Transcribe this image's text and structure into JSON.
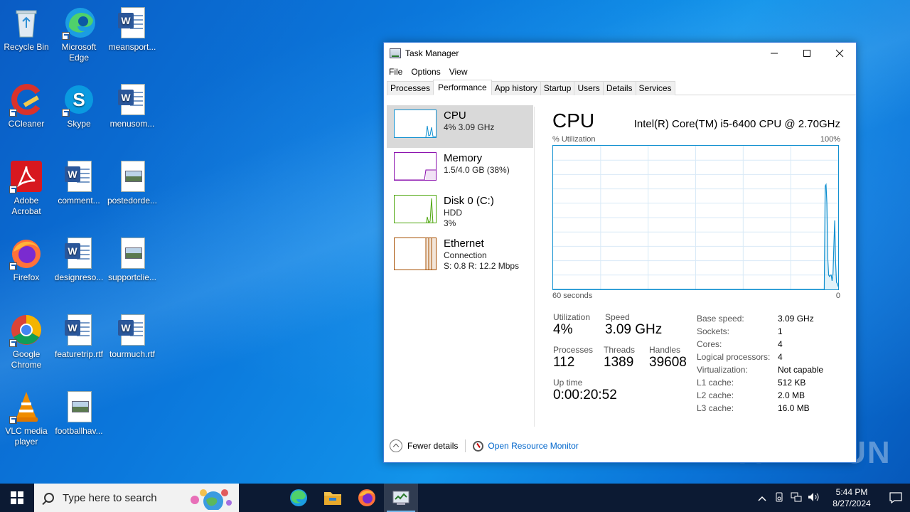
{
  "desktop": {
    "icons": [
      {
        "label": "Recycle Bin"
      },
      {
        "label": "Microsoft Edge"
      },
      {
        "label": "meansport..."
      },
      {
        "label": "CCleaner"
      },
      {
        "label": "Skype"
      },
      {
        "label": "menusom..."
      },
      {
        "label": "Adobe Acrobat"
      },
      {
        "label": "comment..."
      },
      {
        "label": "postedorde..."
      },
      {
        "label": "Firefox"
      },
      {
        "label": "designreso..."
      },
      {
        "label": "supportclie..."
      },
      {
        "label": "Google Chrome"
      },
      {
        "label": "featuretrip.rtf"
      },
      {
        "label": "tourmuch.rtf"
      },
      {
        "label": "VLC media player"
      },
      {
        "label": "footballhav..."
      }
    ]
  },
  "window": {
    "title": "Task Manager",
    "menu": [
      "File",
      "Options",
      "View"
    ],
    "tabs": [
      "Processes",
      "Performance",
      "App history",
      "Startup",
      "Users",
      "Details",
      "Services"
    ],
    "active_tab": "Performance",
    "resources": [
      {
        "name": "CPU",
        "sub1": "4% 3.09 GHz",
        "sub2": "",
        "color": "#1190d0"
      },
      {
        "name": "Memory",
        "sub1": "1.5/4.0 GB (38%)",
        "sub2": "",
        "color": "#8b12ae"
      },
      {
        "name": "Disk 0 (C:)",
        "sub1": "HDD",
        "sub2": "3%",
        "color": "#4da60c"
      },
      {
        "name": "Ethernet",
        "sub1": "Connection",
        "sub2": "S: 0.8 R: 12.2 Mbps",
        "color": "#a74f01"
      }
    ],
    "detail": {
      "heading": "CPU",
      "model": "Intel(R) Core(TM) i5-6400 CPU @ 2.70GHz",
      "graph_top_left": "% Utilization",
      "graph_top_right": "100%",
      "graph_bottom_left": "60 seconds",
      "graph_bottom_right": "0",
      "stats": {
        "utilization_label": "Utilization",
        "utilization": "4%",
        "speed_label": "Speed",
        "speed": "3.09 GHz",
        "processes_label": "Processes",
        "processes": "112",
        "threads_label": "Threads",
        "threads": "1389",
        "handles_label": "Handles",
        "handles": "39608",
        "uptime_label": "Up time",
        "uptime": "0:00:20:52"
      },
      "specs": [
        {
          "k": "Base speed:",
          "v": "3.09 GHz"
        },
        {
          "k": "Sockets:",
          "v": "1"
        },
        {
          "k": "Cores:",
          "v": "4"
        },
        {
          "k": "Logical processors:",
          "v": "4"
        },
        {
          "k": "Virtualization:",
          "v": "Not capable"
        },
        {
          "k": "L1 cache:",
          "v": "512 KB"
        },
        {
          "k": "L2 cache:",
          "v": "2.0 MB"
        },
        {
          "k": "L3 cache:",
          "v": "16.0 MB"
        }
      ]
    },
    "footer": {
      "fewer_details": "Fewer details",
      "resource_monitor": "Open Resource Monitor"
    }
  },
  "cpu_history_percent": [
    0,
    0,
    0,
    0,
    0,
    0,
    0,
    0,
    0,
    0,
    0,
    0,
    0,
    0,
    0,
    0,
    0,
    0,
    0,
    0,
    0,
    0,
    0,
    0,
    0,
    0,
    0,
    0,
    0,
    0,
    0,
    0,
    0,
    0,
    0,
    0,
    0,
    0,
    0,
    0,
    0,
    0,
    0,
    0,
    0,
    0,
    0,
    0,
    0,
    0,
    0,
    0,
    0,
    0,
    0,
    0,
    0,
    0,
    0,
    0,
    0,
    0,
    0,
    0,
    0,
    0,
    0,
    0,
    0,
    0,
    0,
    0,
    0,
    0,
    0,
    0,
    0,
    0,
    0,
    0,
    0,
    0,
    0,
    0,
    0,
    0,
    0,
    0,
    0,
    0,
    0,
    0,
    0,
    0,
    0,
    0,
    0,
    0,
    0,
    0,
    0,
    0,
    0,
    0,
    0,
    0,
    0,
    0,
    0,
    0,
    0,
    0,
    0,
    0,
    0,
    0,
    0,
    0,
    0,
    0,
    0,
    0,
    0,
    0,
    0,
    0,
    0,
    0,
    0,
    0,
    0,
    0,
    0,
    0,
    0,
    0,
    0,
    0,
    0,
    0,
    0,
    0,
    0,
    0,
    0,
    0,
    0,
    0,
    0,
    0,
    0,
    0,
    0,
    0,
    0,
    0,
    0,
    0,
    0,
    0,
    0,
    0,
    0,
    0,
    0,
    0,
    0,
    0,
    0,
    0,
    0,
    0,
    0,
    0,
    0,
    0,
    0,
    0,
    0,
    0,
    0,
    0,
    0,
    0,
    0,
    0,
    0,
    0,
    0,
    0,
    0,
    0,
    0,
    0,
    0,
    0,
    0,
    0,
    0,
    0,
    0,
    0,
    0,
    0,
    0,
    0,
    0,
    0,
    0,
    0,
    0,
    0,
    0,
    0,
    0,
    0,
    0,
    0,
    0,
    0,
    0,
    0,
    0,
    0,
    0,
    0,
    0,
    0,
    0,
    0,
    0,
    0,
    0,
    0,
    0,
    0,
    0,
    0,
    0,
    0,
    0,
    0,
    0,
    0,
    0,
    0,
    0,
    0,
    0,
    0,
    0,
    0,
    0,
    0,
    0,
    0,
    0,
    0,
    0,
    0,
    0,
    0,
    0,
    0,
    0,
    0,
    0,
    0,
    0,
    0,
    0,
    0,
    0,
    0,
    0,
    0,
    0,
    0,
    0,
    0,
    0,
    0,
    0,
    0,
    0,
    0,
    0,
    0,
    0,
    0,
    0,
    0,
    0,
    0,
    0,
    0,
    0,
    0,
    0,
    0,
    0,
    0,
    0,
    0,
    0,
    0,
    0,
    0,
    0,
    0,
    0,
    0,
    0,
    72,
    73,
    60,
    22,
    10,
    9,
    10,
    10,
    6,
    11,
    30,
    48,
    20,
    5,
    4,
    2
  ],
  "taskbar": {
    "search_placeholder": "Type here to search",
    "time": "5:44 PM",
    "date": "8/27/2024"
  },
  "watermark": "ANY RUN"
}
